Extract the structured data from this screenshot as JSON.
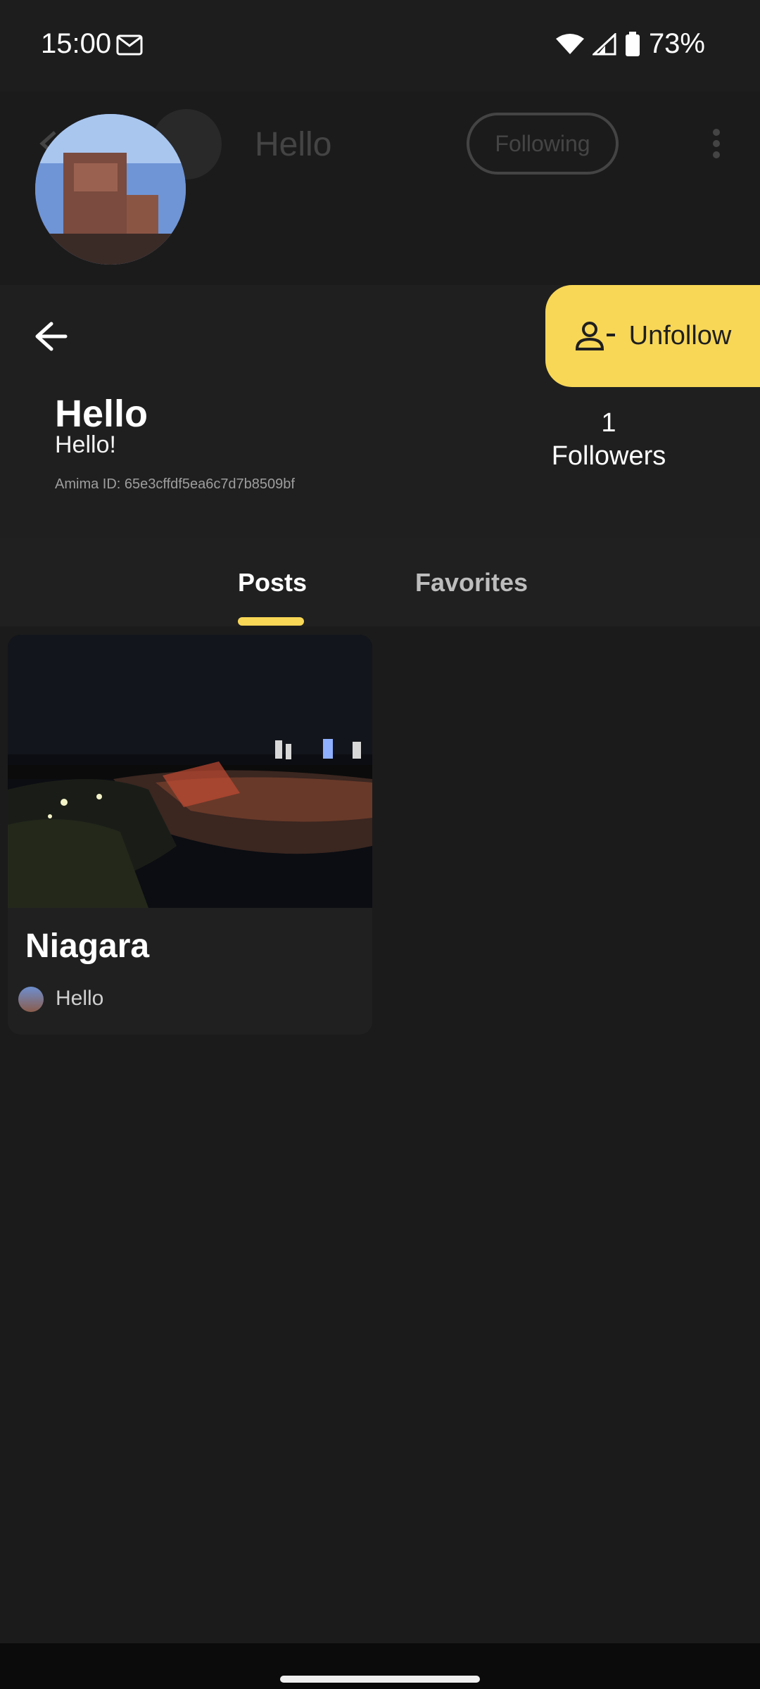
{
  "status": {
    "time": "15:00",
    "battery": "73%"
  },
  "collapsed_header": {
    "title": "Hello",
    "follow_label": "Following"
  },
  "profile": {
    "name": "Hello",
    "bio": "Hello!",
    "id_line": "Amima ID: 65e3cffdf5ea6c7d7b8509bf",
    "followers_count": "1",
    "followers_label": "Followers",
    "unfollow_label": "Unfollow"
  },
  "tabs": [
    {
      "label": "Posts",
      "active": true
    },
    {
      "label": "Favorites",
      "active": false
    }
  ],
  "posts": [
    {
      "title": "Niagara",
      "author": "Hello"
    }
  ],
  "colors": {
    "accent": "#f8d757",
    "background": "#1b1b1b"
  },
  "icons": {
    "back": "arrow-left-icon",
    "unfollow": "person-remove-icon",
    "mail": "mail-icon",
    "wifi": "wifi-icon",
    "signal": "signal-icon",
    "battery": "battery-icon",
    "more": "more-vertical-icon"
  }
}
